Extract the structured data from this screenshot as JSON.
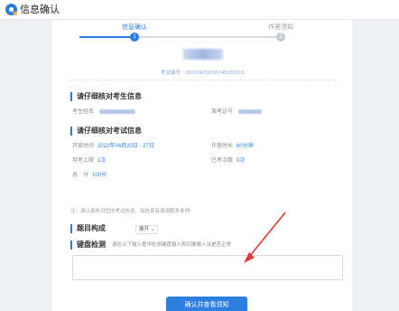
{
  "app": {
    "title": "信息确认"
  },
  "steps": [
    {
      "label": "信息确认",
      "num": "1"
    },
    {
      "label": "作答须知",
      "num": "2"
    }
  ],
  "candidate": {
    "ticket": "考试编号：20220420370074B037016"
  },
  "candidate_info": {
    "title": "请仔细核对考生信息",
    "name_label": "考生姓名",
    "id_label": "准考证号"
  },
  "exam_info": {
    "title": "请仔细核对考试信息",
    "open_time_label": "开放时间",
    "open_time": "2022年04月20日 - 27日",
    "duration_label": "作答时长",
    "duration": "60分钟",
    "attempts_label": "可考上限",
    "attempts": "1次",
    "taken_label": "已考次数",
    "taken": "0次",
    "score_label": "总　分",
    "score": "100分"
  },
  "note": "注：请认真核对您的考试信息，如信息有误请联系老师!",
  "question_structure": {
    "title": "题目构成",
    "toggle": "展开 ⌄"
  },
  "keyboard_check": {
    "title": "键盘检测",
    "hint": "请在以下输入框中检测键盘输入和切换输入法是否正常",
    "value": ""
  },
  "confirm_button": "确认并查看须知",
  "colors": {
    "accent": "#2a7de1",
    "arrow": "#e53935"
  }
}
